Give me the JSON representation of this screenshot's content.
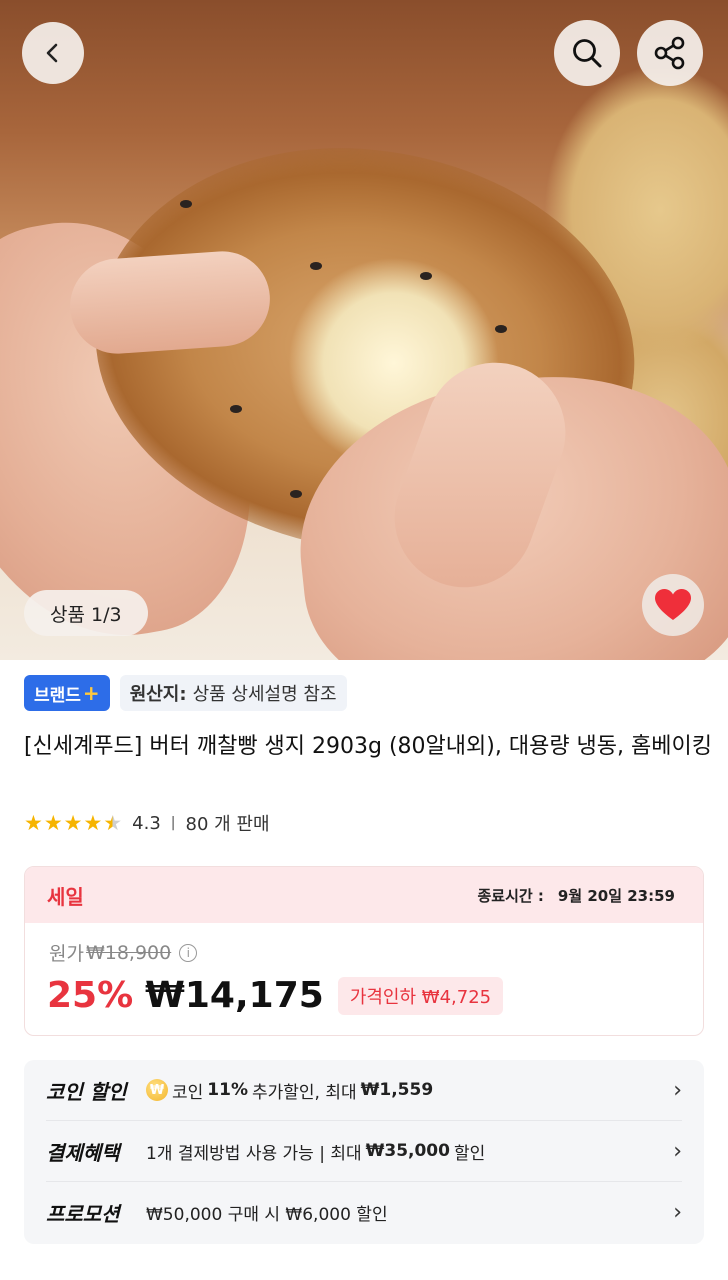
{
  "gallery": {
    "counter": "상품 1/3"
  },
  "tags": {
    "brand_label": "브랜드",
    "brand_plus": "+",
    "origin_key": "원산지:",
    "origin_value": "상품 상세설명 참조"
  },
  "product": {
    "title": "[신세계푸드] 버터 깨찰빵 생지 2903g (80알내외), 대용량 냉동, 홈베이킹",
    "rating": "4.3",
    "rating_stars": 4.3,
    "sold": "80 개 판매"
  },
  "sale": {
    "label": "세일",
    "end_label": "종료시간 :",
    "end_value": "9월 20일 23:59",
    "original_label": "원가",
    "original_price": "₩18,900",
    "discount_pct": "25%",
    "price": "₩14,175",
    "price_drop": "가격인하 ₩4,725"
  },
  "benefits": [
    {
      "key": "코인 할인",
      "prefix": "코인 ",
      "bold": "11%",
      "suffix": " 추가할인, 최대 ",
      "bold2": "₩1,559"
    },
    {
      "key": "결제혜택",
      "prefix": "1개 결제방법 사용 가능 | 최대 ",
      "bold": "₩35,000",
      "suffix": " 할인",
      "bold2": ""
    },
    {
      "key": "프로모션",
      "prefix": "₩50,000 구매 시 ₩6,000 할인",
      "bold": "",
      "suffix": "",
      "bold2": ""
    }
  ],
  "icons": {
    "back": "back-arrow-icon",
    "search": "search-icon",
    "share": "share-icon",
    "wishlist": "heart-icon",
    "coin": "coin-icon",
    "chevron": "chevron-right-icon"
  },
  "colors": {
    "accent_red": "#e8343f",
    "brand_blue": "#2d6de8",
    "star": "#f6b400"
  }
}
